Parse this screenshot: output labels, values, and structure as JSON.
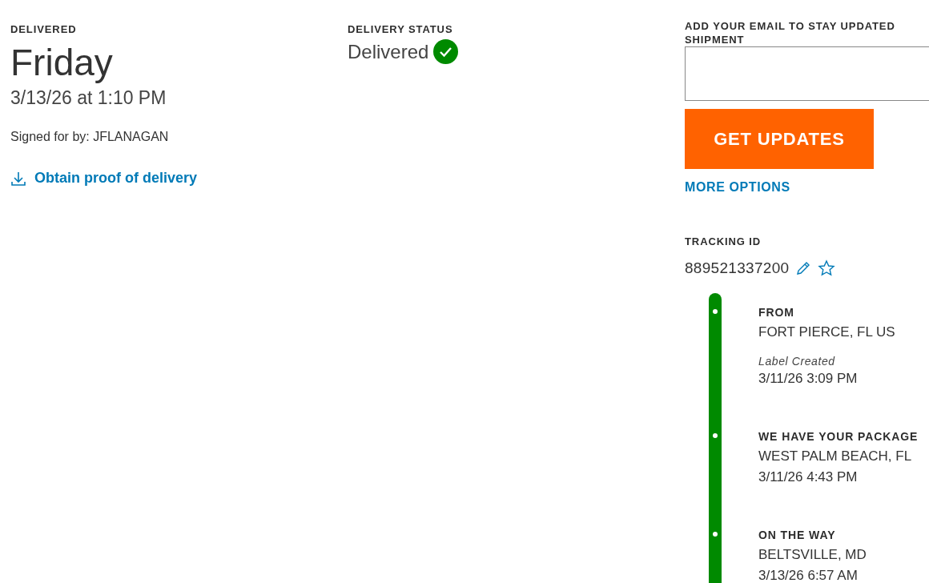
{
  "delivery": {
    "label": "DELIVERED",
    "day": "Friday",
    "datetime": "3/13/26 at 1:10 PM",
    "signed_for": "Signed for by: JFLANAGAN",
    "proof_link": "Obtain proof of delivery"
  },
  "status": {
    "label": "DELIVERY STATUS",
    "value": "Delivered",
    "delivered": true
  },
  "email": {
    "label_lines": [
      "ADD YOUR EMAIL TO STAY UPDATED",
      "SHIPMENT"
    ],
    "button": "GET UPDATES",
    "more_options": "MORE OPTIONS"
  },
  "tracking": {
    "label": "TRACKING ID",
    "number": "889521337200"
  },
  "events": [
    {
      "title": "FROM",
      "location": "FORT PIERCE, FL US",
      "note": "Label Created",
      "time": "3/11/26 3:09 PM"
    },
    {
      "title": "WE HAVE YOUR PACKAGE",
      "location": "WEST PALM BEACH, FL",
      "time": "3/11/26 4:43 PM"
    },
    {
      "title": "ON THE WAY",
      "location": "BELTSVILLE, MD",
      "time": "3/13/26 6:57 AM"
    }
  ]
}
